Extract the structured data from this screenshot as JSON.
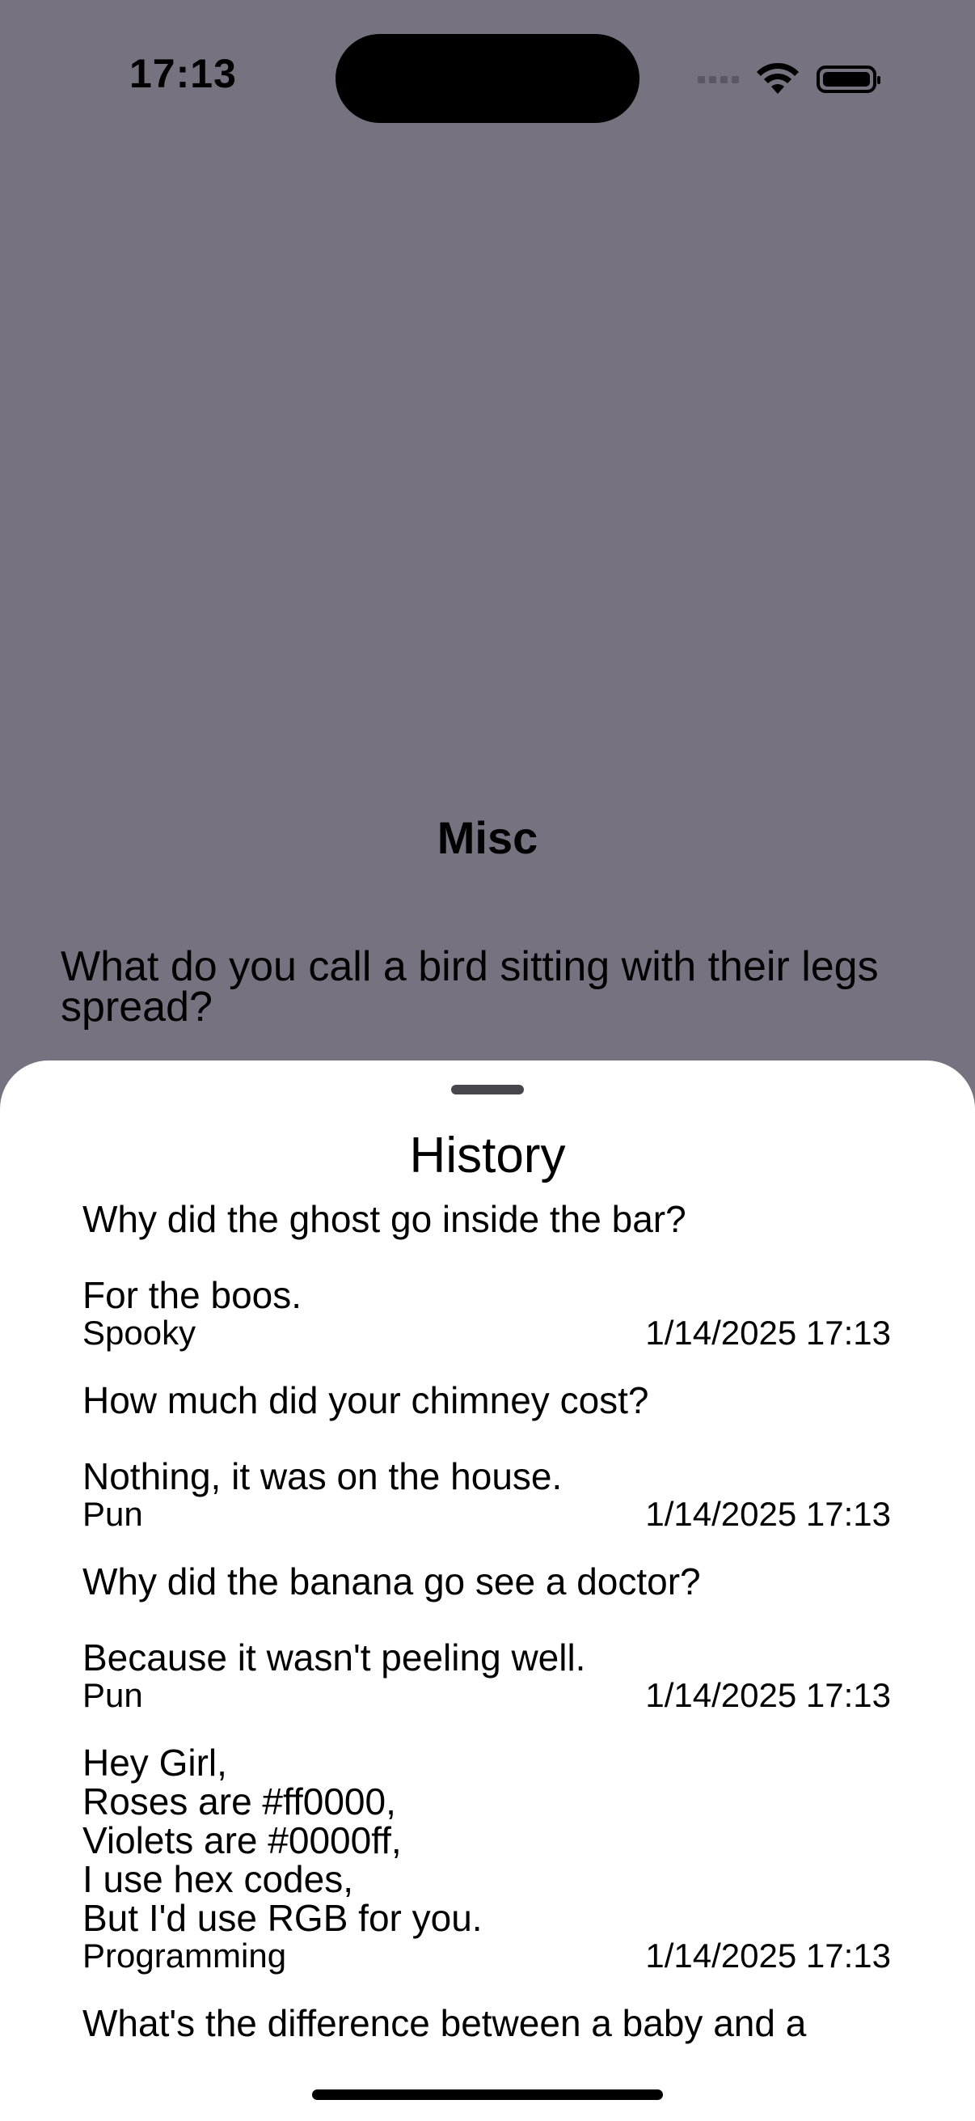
{
  "status_bar": {
    "time": "17:13"
  },
  "background": {
    "category": "Misc",
    "joke_setup": "What do you call a bird sitting with their legs spread?"
  },
  "sheet": {
    "title": "History",
    "entries": [
      {
        "setup": "Why did the ghost go inside the bar?",
        "punchline": "For the boos.",
        "category": "Spooky",
        "timestamp": "1/14/2025 17:13"
      },
      {
        "setup": "How much did your chimney cost?",
        "punchline": "Nothing, it was on the house.",
        "category": "Pun",
        "timestamp": "1/14/2025 17:13"
      },
      {
        "setup": "Why did the banana go see a doctor?",
        "punchline": "Because it wasn't peeling well.",
        "category": "Pun",
        "timestamp": "1/14/2025 17:13"
      },
      {
        "joke": "Hey Girl,\nRoses are #ff0000,\nViolets are #0000ff,\nI use hex codes,\nBut I'd use RGB for you.",
        "category": "Programming",
        "timestamp": "1/14/2025 17:13"
      },
      {
        "setup": "What's the difference between a baby and a"
      }
    ]
  },
  "colors": {
    "background_dim": "#777280",
    "sheet": "#ffffff",
    "text": "#000000"
  }
}
